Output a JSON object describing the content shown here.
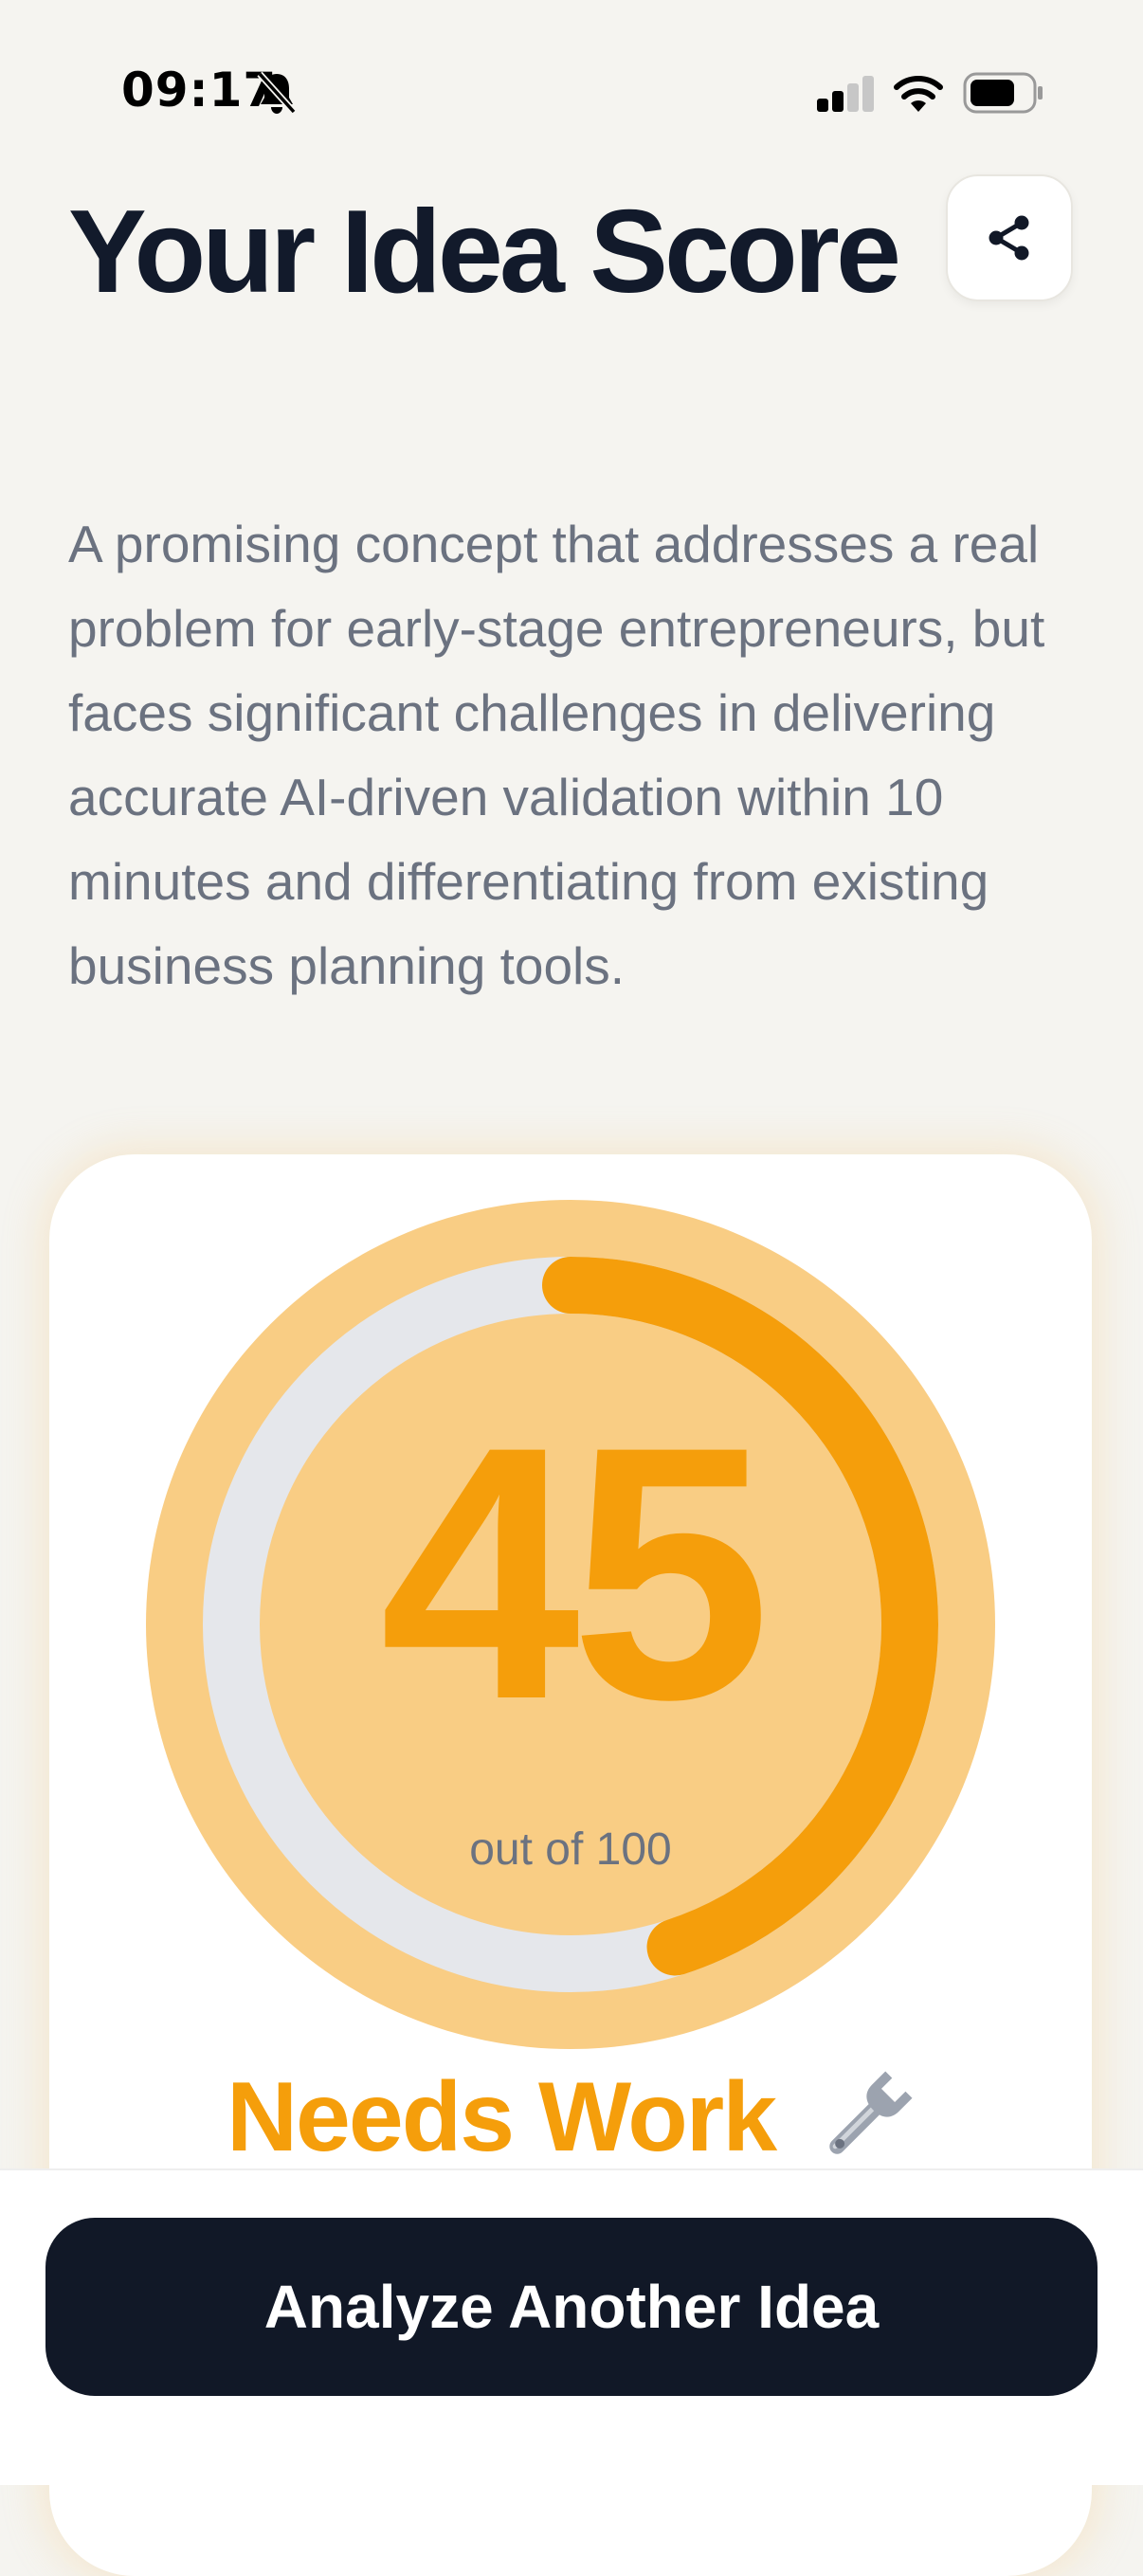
{
  "status_bar": {
    "time": "09:17",
    "icons": [
      "bell-off-icon",
      "cellular-signal-icon",
      "wifi-icon",
      "battery-icon"
    ]
  },
  "header": {
    "title": "Your Idea Score",
    "share_icon": "share-icon"
  },
  "summary": "A promising concept that addresses a real problem for early-stage entrepreneurs, but faces significant challenges in delivering accurate AI-driven validation within 10 minutes and differentiating from existing business planning tools.",
  "score": {
    "value": "45",
    "caption": "out of 100",
    "progress_fraction": 0.45,
    "verdict": "Needs Work",
    "verdict_icon": "wrench-icon"
  },
  "colors": {
    "accent": "#f59e0b",
    "accent_light": "#f9cd84",
    "track": "#e5e7eb",
    "primary_button": "#111827",
    "background": "#f5f4f0"
  },
  "footer": {
    "analyze_button_label": "Analyze Another Idea"
  }
}
